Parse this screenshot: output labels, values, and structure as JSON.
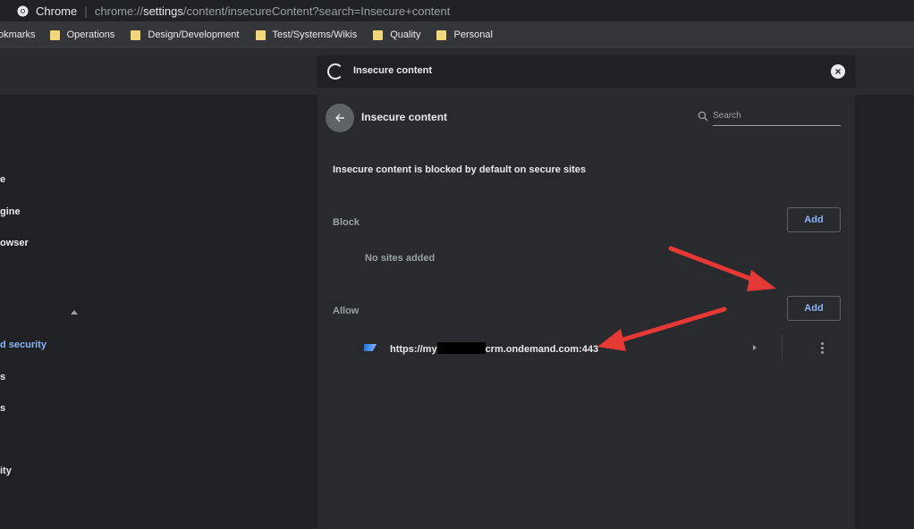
{
  "address_bar": {
    "site_name": "Chrome",
    "url_prefix": "chrome://",
    "url_strong": "settings",
    "url_rest": "/content/insecureContent?search=Insecure+content"
  },
  "bookmarks": [
    {
      "label": "okmarks",
      "icon": "folder-icon"
    },
    {
      "label": "Operations",
      "icon": "folder-icon"
    },
    {
      "label": "Design/Development",
      "icon": "folder-icon"
    },
    {
      "label": "Test/Systems/Wikis",
      "icon": "folder-icon"
    },
    {
      "label": "Quality",
      "icon": "folder-icon"
    },
    {
      "label": "Personal",
      "icon": "folder-icon"
    }
  ],
  "settings_search": {
    "value": "Insecure content"
  },
  "sidebar": {
    "items": [
      "e",
      "gine",
      "owser",
      "d security",
      "s",
      "s",
      "ity"
    ]
  },
  "page": {
    "title": "Insecure content",
    "search_placeholder": "Search",
    "description": "Insecure content is blocked by default on secure sites",
    "block": {
      "label": "Block",
      "add_label": "Add",
      "empty_text": "No sites added"
    },
    "allow": {
      "label": "Allow",
      "add_label": "Add",
      "site_prefix": "https://my",
      "site_suffix": "crm.ondemand.com:443"
    }
  },
  "colors": {
    "background": "#202124",
    "card": "#292a2d",
    "accent": "#8ab4f8",
    "annotation_arrow": "#e53935"
  }
}
